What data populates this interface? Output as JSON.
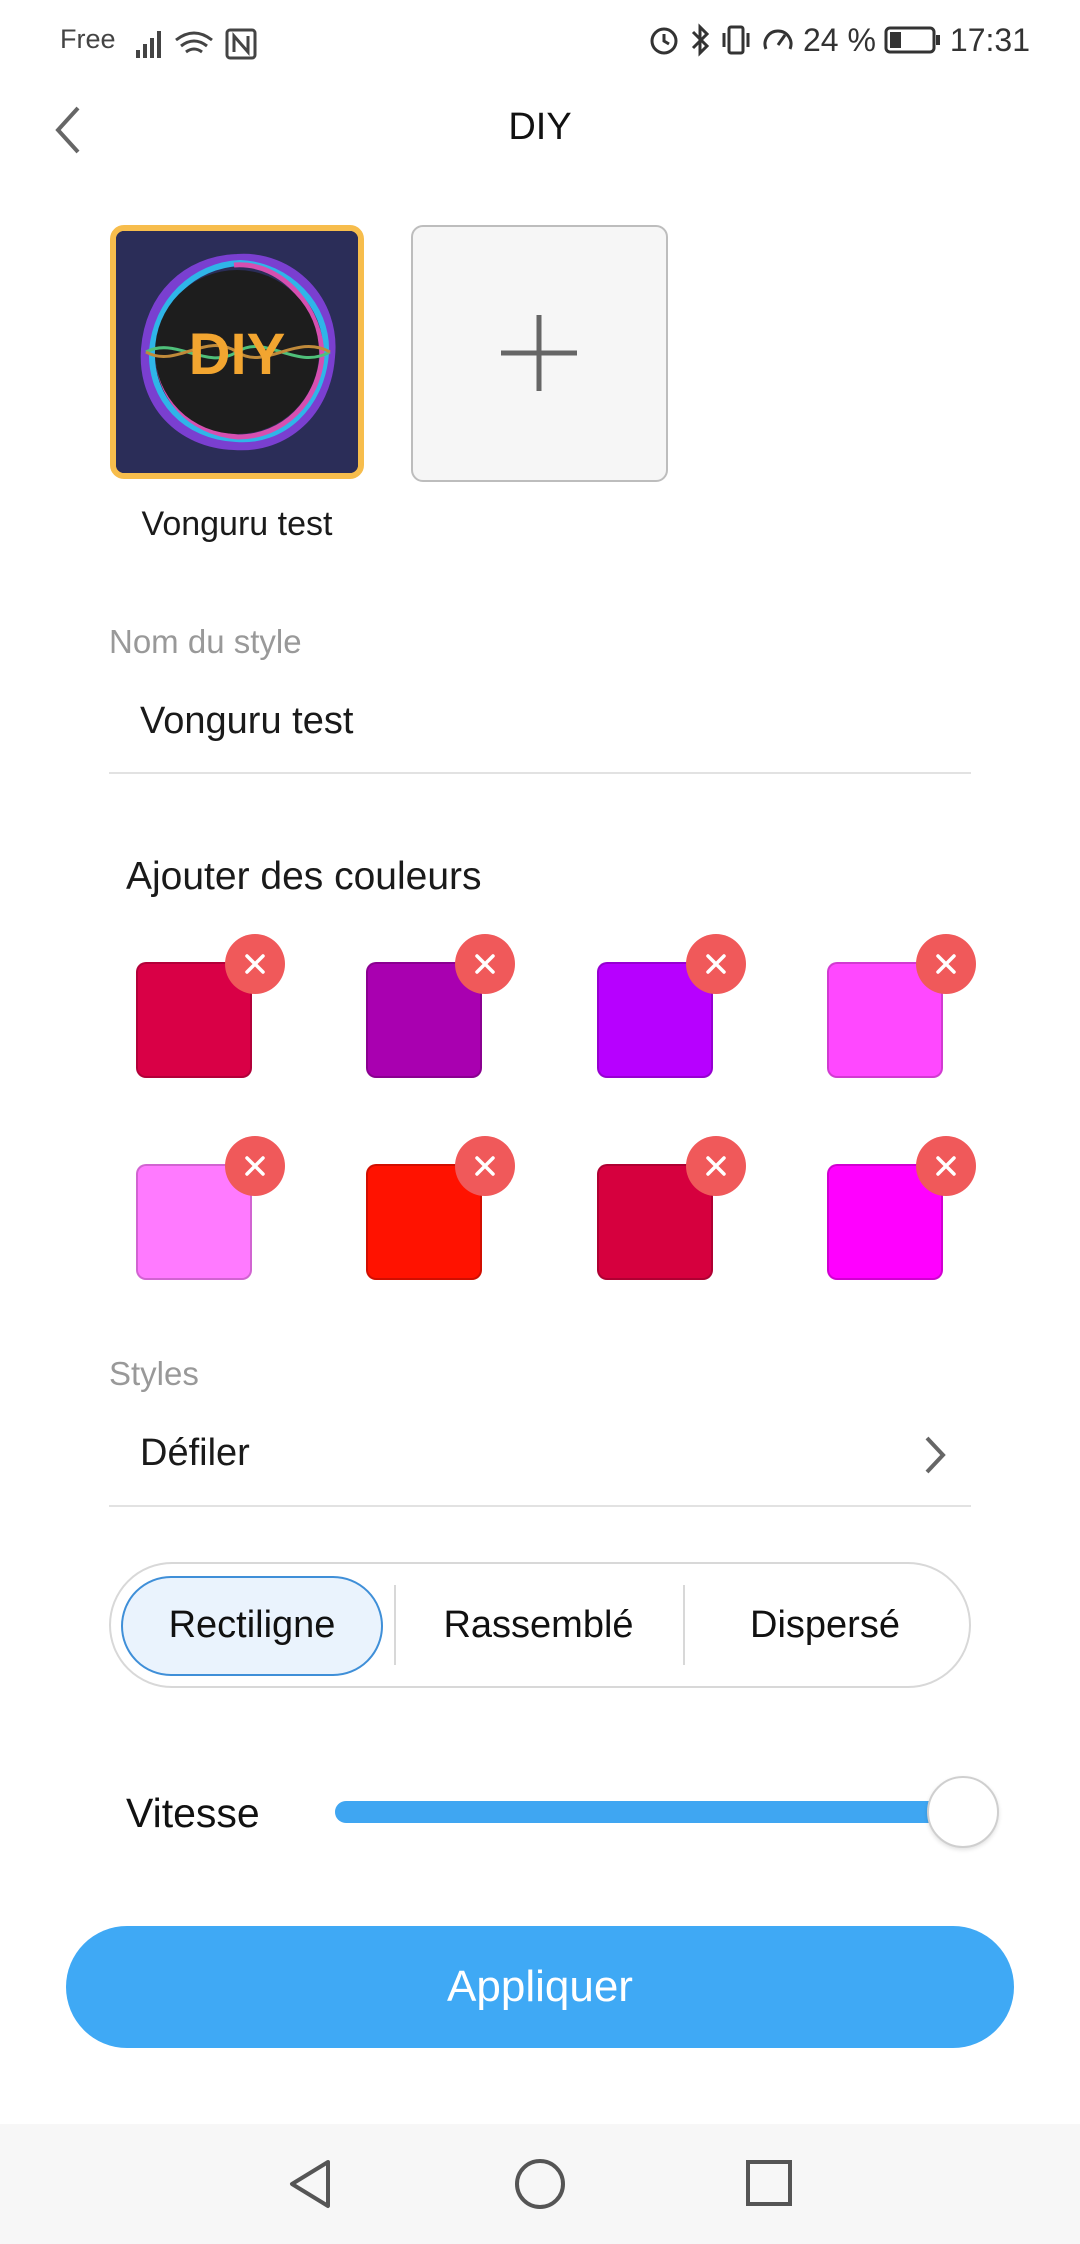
{
  "status_bar": {
    "carrier": "Free",
    "battery": "24 %",
    "time": "17:31"
  },
  "header": {
    "title": "DIY"
  },
  "styles": {
    "items": [
      {
        "label": "Vonguru test",
        "thumbnail_text": "DIY",
        "selected": true
      }
    ],
    "add_label": "+"
  },
  "style_name": {
    "label": "Nom du style",
    "value": "Vonguru test"
  },
  "colors": {
    "title": "Ajouter des couleurs",
    "swatches": [
      "#d90046",
      "#a900b0",
      "#b700ff",
      "#ff48ff",
      "#ff7aff",
      "#ff1200",
      "#d6003e",
      "#ff00ff"
    ]
  },
  "style_select": {
    "label": "Styles",
    "value": "Défiler"
  },
  "mode": {
    "options": [
      "Rectiligne",
      "Rassemblé",
      "Dispersé"
    ],
    "selected": "Rectiligne"
  },
  "speed": {
    "label": "Vitesse",
    "value": 1.0
  },
  "apply_label": "Appliquer",
  "accent_color": "#3fa9f5",
  "selected_border_color": "#f7bd4c",
  "remove_badge_color": "#f0595a",
  "icons": [
    "back-chevron-icon",
    "plus-icon",
    "close-icon",
    "chevron-right-icon",
    "nav-back-icon",
    "nav-home-icon",
    "nav-recents-icon"
  ]
}
